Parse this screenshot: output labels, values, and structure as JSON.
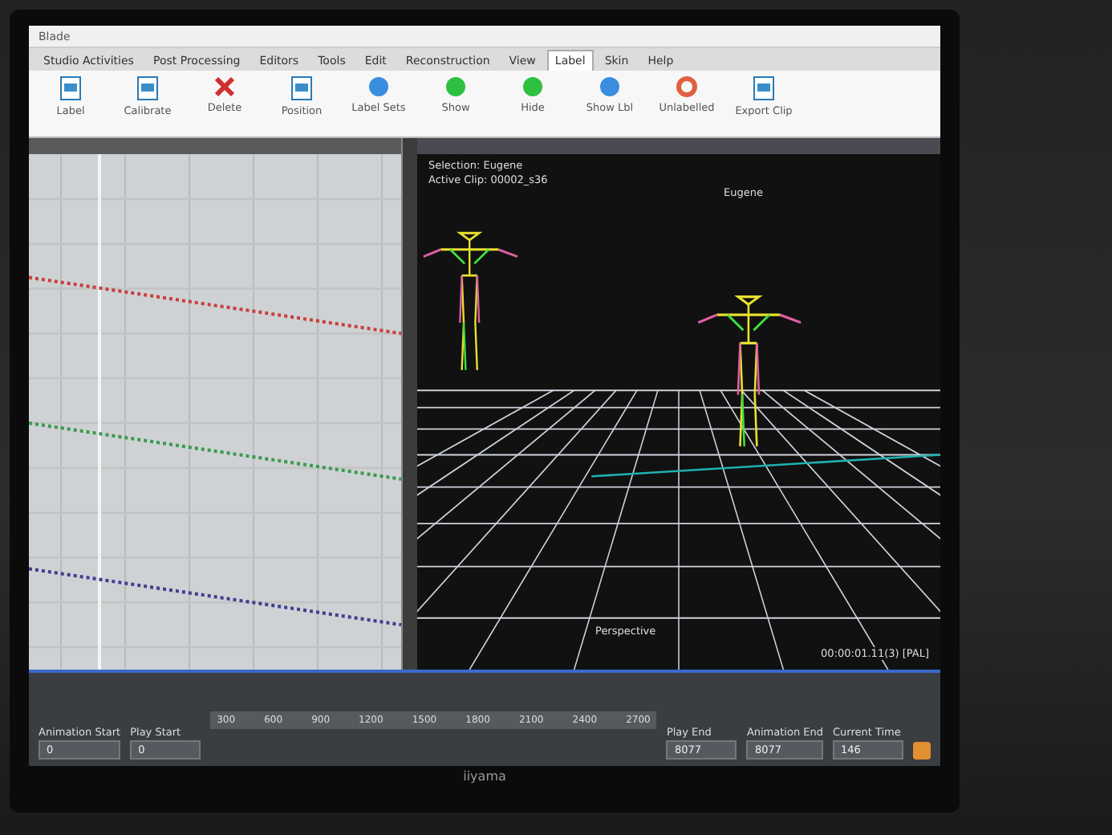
{
  "window": {
    "title": "Blade"
  },
  "ribbon": {
    "tabs": [
      {
        "label": "Studio Activities",
        "selected": false
      },
      {
        "label": "Post Processing",
        "selected": false
      },
      {
        "label": "Editors",
        "selected": false
      },
      {
        "label": "Tools",
        "selected": false
      },
      {
        "label": "Edit",
        "selected": false
      },
      {
        "label": "Reconstruction",
        "selected": false
      },
      {
        "label": "View",
        "selected": false
      },
      {
        "label": "Label",
        "selected": true
      },
      {
        "label": "Skin",
        "selected": false
      },
      {
        "label": "Help",
        "selected": false
      }
    ],
    "buttons": [
      {
        "kind": "doc",
        "label": "Label"
      },
      {
        "kind": "doc",
        "label": "Calibrate"
      },
      {
        "kind": "cross",
        "label": "Delete"
      },
      {
        "kind": "doc",
        "label": "Position"
      },
      {
        "kind": "ball",
        "label": "Label Sets",
        "color": "#3a8ee0"
      },
      {
        "kind": "ball",
        "label": "Show",
        "color": "#2ec040"
      },
      {
        "kind": "ball",
        "label": "Hide",
        "color": "#2ec040"
      },
      {
        "kind": "ball",
        "label": "Show Lbl",
        "color": "#3a8ee0"
      },
      {
        "kind": "ring",
        "label": "Unlabelled"
      },
      {
        "kind": "doc",
        "label": "Export Clip"
      }
    ]
  },
  "graph": {
    "curves": [
      {
        "color": "#c84040"
      },
      {
        "color": "#3a9a50"
      },
      {
        "color": "#404090"
      }
    ]
  },
  "viewport": {
    "selection": "Selection: Eugene",
    "active_clip": "Active Clip: 00002_s36",
    "character": "Eugene",
    "camera": "Perspective",
    "timecode": "00:00:01.11(3) [PAL]"
  },
  "timeline": {
    "fields": [
      {
        "label": "Animation Start",
        "value": "0"
      },
      {
        "label": "Play Start",
        "value": "0"
      },
      {
        "label": "Play End",
        "value": "8077"
      },
      {
        "label": "Animation End",
        "value": "8077"
      },
      {
        "label": "Current Time",
        "value": "146"
      }
    ],
    "ticks": [
      "300",
      "600",
      "900",
      "1200",
      "1500",
      "1800",
      "2100",
      "2400",
      "2700"
    ]
  },
  "monitor": {
    "brand": "iiyama"
  }
}
